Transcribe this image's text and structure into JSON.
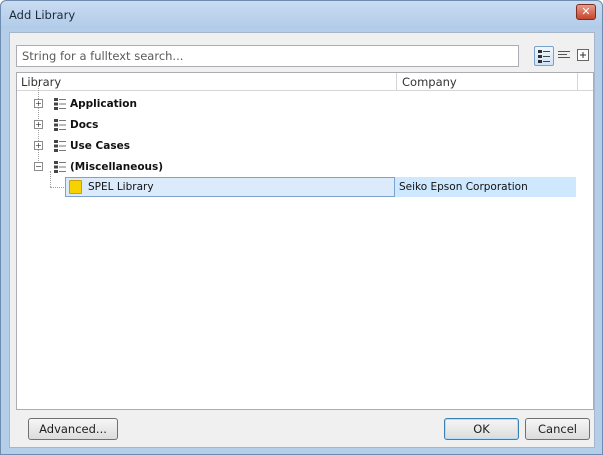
{
  "window": {
    "title": "Add Library",
    "close_label": "✕"
  },
  "search": {
    "placeholder": "String for a fulltext search...",
    "value": ""
  },
  "toolbar": {
    "icons": [
      "details-view-icon",
      "list-view-icon",
      "expand-all-icon"
    ]
  },
  "list": {
    "columns": [
      "Library",
      "Company"
    ],
    "groups": [
      {
        "label": "Application",
        "expanded": false
      },
      {
        "label": "Docs",
        "expanded": false
      },
      {
        "label": "Use Cases",
        "expanded": false
      },
      {
        "label": "(Miscellaneous)",
        "expanded": true
      }
    ],
    "items": [
      {
        "name": "SPEL Library",
        "company": "Seiko Epson Corporation",
        "selected": true
      }
    ]
  },
  "buttons": {
    "advanced": "Advanced...",
    "ok": "OK",
    "cancel": "Cancel"
  },
  "colors": {
    "selection": "#cde8ff",
    "library_icon": "#f8d200",
    "title_bar": "#b1cbe8",
    "close_button": "#c8432c"
  }
}
